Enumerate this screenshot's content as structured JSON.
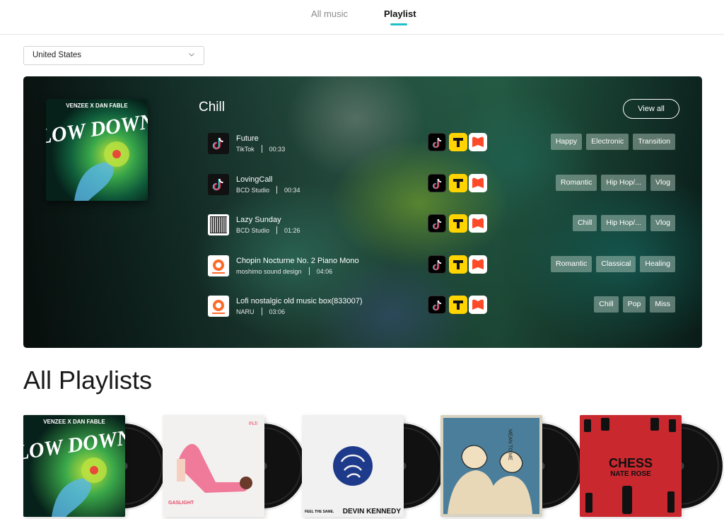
{
  "nav": {
    "tabs": [
      {
        "label": "All music"
      },
      {
        "label": "Playlist"
      }
    ],
    "active_tab": "Playlist"
  },
  "country_select": {
    "value": "United States"
  },
  "featured": {
    "title": "Chill",
    "view_all_label": "View all",
    "cover": {
      "top_text": "VENZEE X DAN FABLE",
      "big_text": "LOW DOWN"
    },
    "tracks": [
      {
        "name": "Future",
        "artist": "TikTok",
        "duration": "00:33",
        "thumb": "tiktok-logo",
        "tags": [
          "Happy",
          "Electronic",
          "Transition"
        ]
      },
      {
        "name": "LovingCall",
        "artist": "BCD Studio",
        "duration": "00:34",
        "thumb": "tiktok-logo",
        "tags": [
          "Romantic",
          "Hip Hop/...",
          "Vlog"
        ]
      },
      {
        "name": "Lazy Sunday",
        "artist": "BCD Studio",
        "duration": "01:26",
        "thumb": "piano-keys",
        "tags": [
          "Chill",
          "Hip Hop/...",
          "Vlog"
        ]
      },
      {
        "name": "Chopin Nocturne No. 2 Piano Mono",
        "artist": "moshimo sound design",
        "duration": "04:06",
        "thumb": "audiostock-logo",
        "tags": [
          "Romantic",
          "Classical",
          "Healing"
        ]
      },
      {
        "name": "Lofi nostalgic old music box(833007)",
        "artist": "NARU",
        "duration": "03:06",
        "thumb": "audiostock-logo",
        "tags": [
          "Chill",
          "Pop",
          "Miss"
        ]
      }
    ],
    "platform_icons": [
      "tiktok-icon",
      "tp-icon",
      "audiostock-icon"
    ],
    "colors": {
      "accent": "#22c1c7",
      "tp_yellow": "#ffd400",
      "audiostock_orange": "#ff6a2a"
    }
  },
  "all_playlists": {
    "title": "All Playlists",
    "items": [
      {
        "cover_text": "VENZEE X DAN FABLE",
        "cover_big": "LOW DOWN",
        "style": "lowdown"
      },
      {
        "cover_text": "INJI",
        "cover_big": "GASLIGHT",
        "style": "gaslight"
      },
      {
        "cover_text": "FEEL THE SAME.",
        "cover_big": "DEVIN KENNEDY",
        "style": "devin"
      },
      {
        "cover_text": "MEAN TO ME",
        "cover_big": "",
        "style": "meantome"
      },
      {
        "cover_text": "CHESS",
        "cover_big": "NATE ROSE",
        "style": "chess"
      }
    ]
  }
}
